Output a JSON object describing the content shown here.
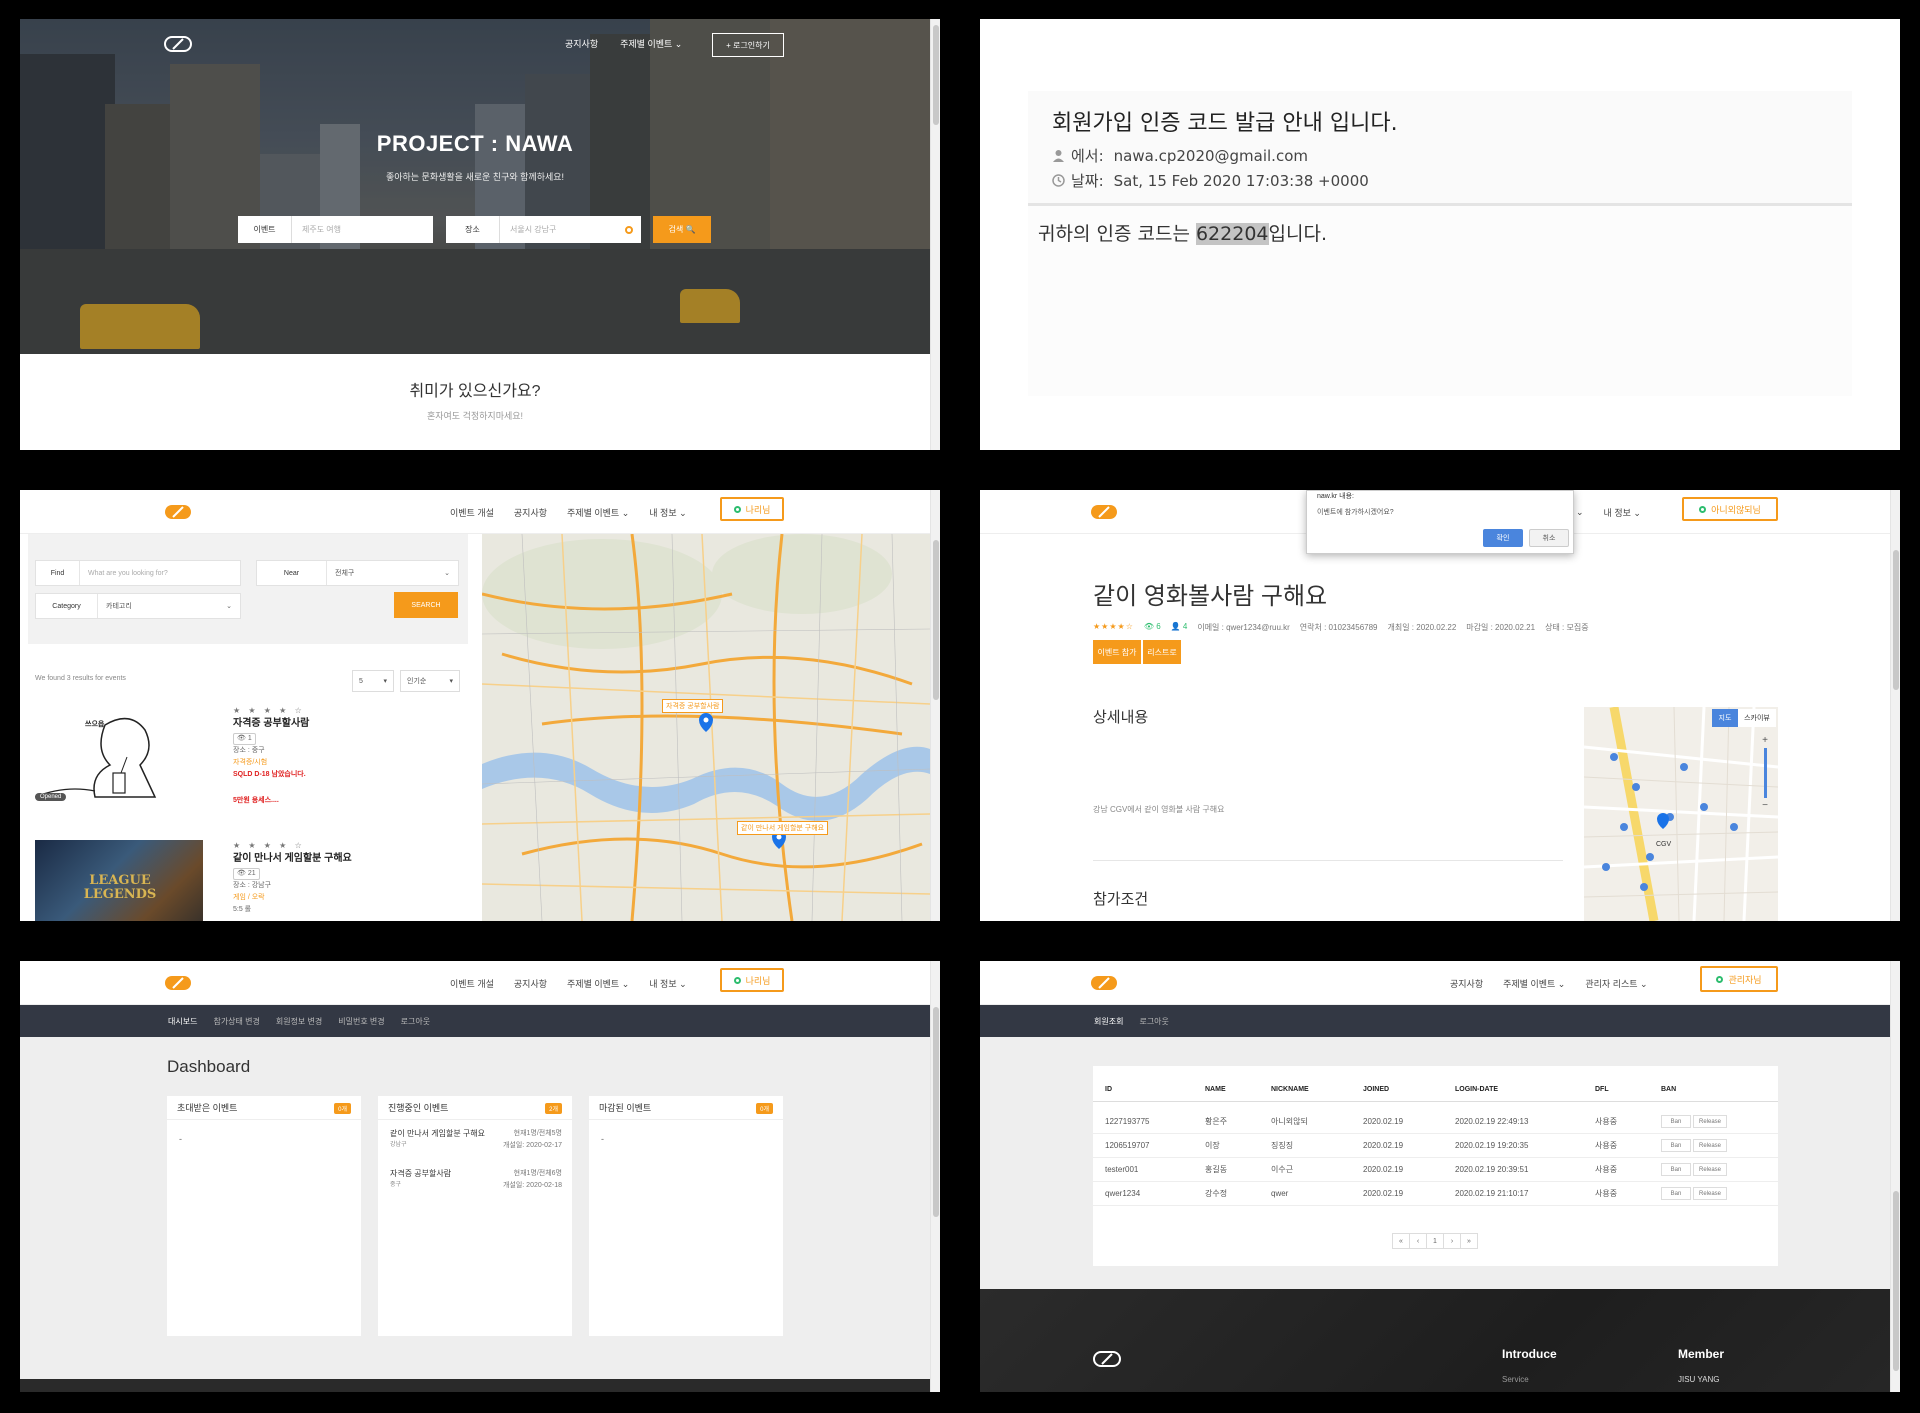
{
  "colors": {
    "accent": "#f59a1b",
    "online": "#2dbd6e",
    "subnav": "#333844",
    "dialog_ok": "#4a85dd"
  },
  "panel1": {
    "nav": [
      "공지사항",
      "주제별 이벤트 ⌄"
    ],
    "login_button": "+ 로그인하기",
    "title": "PROJECT : NAWA",
    "subtitle": "좋아하는 문화생활을 새로운 친구와 함께하세요!",
    "event_label": "이벤트",
    "event_placeholder": "제주도 여행",
    "place_label": "장소",
    "place_placeholder": "서울시 강남구",
    "search_button": "검색 🔍",
    "heading": "취미가 있으신가요?",
    "subheading": "혼자여도 걱정하지마세요!"
  },
  "panel2": {
    "subject": "회원가입 인증 코드 발급 안내 입니다.",
    "from_label": "에서:",
    "from_value": "nawa.cp2020@gmail.com",
    "date_label": "날짜:",
    "date_value": "Sat, 15 Feb 2020 17:03:38 +0000",
    "body_prefix": "귀하의 인증 코드는 ",
    "code": "622204",
    "body_suffix": "입니다."
  },
  "user_nav": [
    "이벤트 개설",
    "공지사항",
    "주제별 이벤트 ⌄",
    "내 정보 ⌄"
  ],
  "user_button": "나리님",
  "panel3": {
    "find_label": "Find",
    "find_placeholder": "What are you looking for?",
    "near_label": "Near",
    "near_value": "전체구",
    "category_label": "Category",
    "category_value": "카테고리",
    "search_button": "SEARCH",
    "found_text": "We found 3 results for events",
    "page_size": "5",
    "sort": "인기순",
    "events": [
      {
        "stars": "★ ★ ★ ★ ☆",
        "title": "자격증 공부할사람",
        "views": "👁 1",
        "place": "장소 : 중구",
        "category": "자격증/시험",
        "note1": "SQLD D-18 남았습니다.",
        "note2": "5만원 용세스....",
        "badge": "Opened",
        "thumb_text": "쓰으읍"
      },
      {
        "stars": "★ ★ ★ ★ ☆",
        "title": "같이 만나서 게임할분 구해요",
        "views": "👁 21",
        "place": "장소 : 강남구",
        "category": "게임 / 오락",
        "note1": "5:5 롤",
        "thumb_text": "LEAGUE LEGENDS"
      }
    ],
    "map_labels": [
      "자격증 공부할사람",
      "같이 만나서 게임할분 구해요"
    ]
  },
  "panel4": {
    "dialog_title": "naw.kr 내용:",
    "dialog_message": "이벤트에 참가하시겠어요?",
    "dialog_ok": "확인",
    "dialog_cancel": "취소",
    "nav_partial": [
      "⌄",
      "내 정보 ⌄"
    ],
    "user_button": "아니외않되님",
    "title": "같이 영화볼사람 구해요",
    "stars": "★★★★☆",
    "views": "👁 6",
    "members": "👤 4",
    "email": "이메일 : qwer1234@ruu.kr",
    "contact": "연락처 : 01023456789",
    "open_date": "개최일 : 2020.02.22",
    "close_date": "마감일 : 2020.02.21",
    "status": "상태 : 모집중",
    "join_button": "이벤트 참가",
    "list_button": "리스트로",
    "detail_heading": "상세내용",
    "detail_text": "강남 CGV에서 같이 영화볼 사람 구해요",
    "condition_heading": "참가조건",
    "map_tabs": [
      "지도",
      "스카이뷰"
    ],
    "map_label": "CGV"
  },
  "panel5": {
    "subnav": [
      "대시보드",
      "참가상태 변경",
      "회원정보 변경",
      "비밀번호 변경",
      "로그아웃"
    ],
    "heading": "Dashboard",
    "cards": [
      {
        "title": "초대받은 이벤트",
        "badge": "0개",
        "empty": "-"
      },
      {
        "title": "진행중인 이벤트",
        "badge": "2개",
        "items": [
          {
            "name": "같이 만나서 게임할분 구해요",
            "count": "현재1명/전체5명",
            "loc": "강남구",
            "open": "개설일: 2020-02-17"
          },
          {
            "name": "자격증 공부할사람",
            "count": "현재1명/전체6명",
            "loc": "중구",
            "open": "개설일: 2020-02-18"
          }
        ]
      },
      {
        "title": "마감된 이벤트",
        "badge": "0개",
        "empty": "-"
      }
    ]
  },
  "panel6": {
    "nav": [
      "공지사항",
      "주제별 이벤트 ⌄",
      "관리자 리스트 ⌄"
    ],
    "admin_button": "관리자님",
    "subnav": [
      "회원조회",
      "로그아웃"
    ],
    "columns": [
      "ID",
      "NAME",
      "NICKNAME",
      "JOINED",
      "LOGIN-DATE",
      "DFL",
      "BAN"
    ],
    "rows": [
      [
        "1227193775",
        "황은주",
        "아니외않되",
        "2020.02.19",
        "2020.02.19 22:49:13",
        "사용중"
      ],
      [
        "1206519707",
        "이장",
        "징징징",
        "2020.02.19",
        "2020.02.19 19:20:35",
        "사용중"
      ],
      [
        "tester001",
        "홍길동",
        "이수근",
        "2020.02.19",
        "2020.02.19 20:39:51",
        "사용중"
      ],
      [
        "qwer1234",
        "강수정",
        "qwer",
        "2020.02.19",
        "2020.02.19 21:10:17",
        "사용중"
      ]
    ],
    "ban_label": "Ban",
    "release_label": "Release",
    "pager": [
      "«",
      "‹",
      "1",
      "›",
      "»"
    ],
    "footer_introduce": "Introduce",
    "footer_service": "Service",
    "footer_member": "Member",
    "footer_member_name": "JISU YANG"
  }
}
